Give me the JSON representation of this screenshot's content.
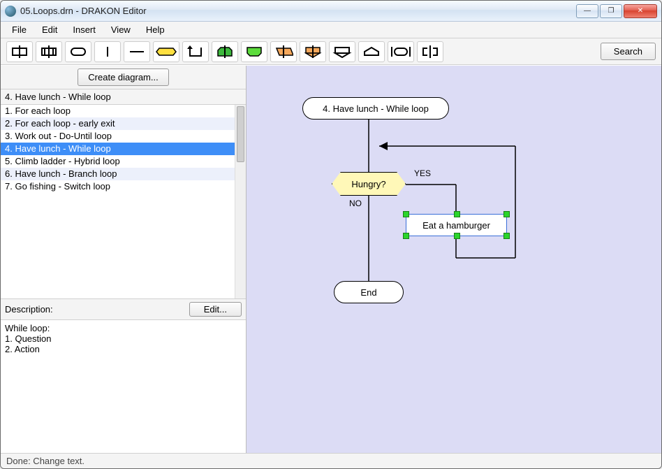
{
  "window": {
    "title": "05.Loops.drn - DRAKON Editor"
  },
  "menu": {
    "items": [
      "File",
      "Edit",
      "Insert",
      "View",
      "Help"
    ]
  },
  "toolbar": {
    "icons": [
      "action-icon",
      "insertion-icon",
      "terminator-icon",
      "vertical-line-icon",
      "horizontal-line-icon",
      "question-icon",
      "arrow-loop-icon",
      "begin-for-icon",
      "end-for-icon",
      "shelf-icon",
      "case-icon",
      "address-icon",
      "branch-icon",
      "timer-icon",
      "pause-icon"
    ],
    "search": "Search"
  },
  "sidebar": {
    "create": "Create diagram...",
    "breadcrumb": "4. Have lunch - While loop",
    "items": [
      "1. For each loop",
      "2. For each loop - early exit",
      "3. Work out - Do-Until loop",
      "4. Have lunch - While loop",
      "5. Climb ladder - Hybrid loop",
      "6. Have lunch - Branch loop",
      "7. Go fishing - Switch loop"
    ],
    "selected_index": 3
  },
  "description": {
    "label": "Description:",
    "edit": "Edit...",
    "text": "While loop:\n1. Question\n2. Action"
  },
  "diagram": {
    "title": "4. Have lunch - While loop",
    "question": "Hungry?",
    "action": "Eat a hamburger",
    "end": "End",
    "yes": "YES",
    "no": "NO"
  },
  "status": "Done: Change text.",
  "winbuttons": {
    "min": "—",
    "max": "❐",
    "close": "✕"
  }
}
